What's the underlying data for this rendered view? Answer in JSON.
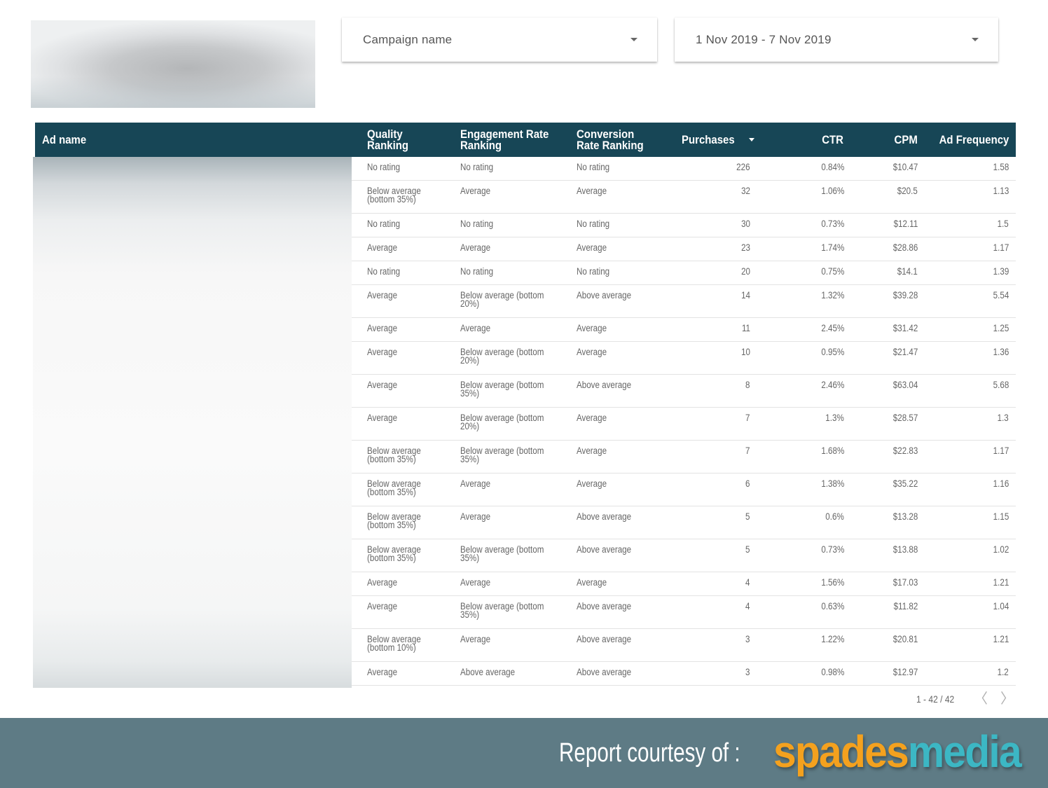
{
  "header": {
    "logo_alt": "blurred-report-logo"
  },
  "filters": {
    "campaign": {
      "label": "Campaign name",
      "icon": "caret-down-icon"
    },
    "date_range": {
      "label": "1 Nov 2019 - 7 Nov 2019",
      "icon": "caret-down-icon"
    }
  },
  "table": {
    "header_bg": "#174656",
    "columns": [
      {
        "key": "ad_name",
        "label": "Ad name"
      },
      {
        "key": "quality_ranking",
        "label": "Quality Ranking"
      },
      {
        "key": "engagement_rate_ranking",
        "label": "Engagement Rate Ranking"
      },
      {
        "key": "conversion_rate_ranking",
        "label": "Conversion Rate Ranking"
      },
      {
        "key": "purchases",
        "label": "Purchases",
        "sorted": "descending",
        "sort_icon": "sort-desc-caret-icon"
      },
      {
        "key": "ctr",
        "label": "CTR"
      },
      {
        "key": "cpm",
        "label": "CPM"
      },
      {
        "key": "ad_frequency",
        "label": "Ad Frequency"
      }
    ],
    "rows": [
      {
        "quality": "No rating",
        "engagement": "No rating",
        "conversion": "No rating",
        "purchases": "226",
        "ctr": "0.84%",
        "cpm": "$10.47",
        "frequency": "1.58"
      },
      {
        "quality": "Below average (bottom 35%)",
        "engagement": "Average",
        "conversion": "Average",
        "purchases": "32",
        "ctr": "1.06%",
        "cpm": "$20.5",
        "frequency": "1.13"
      },
      {
        "quality": "No rating",
        "engagement": "No rating",
        "conversion": "No rating",
        "purchases": "30",
        "ctr": "0.73%",
        "cpm": "$12.11",
        "frequency": "1.5"
      },
      {
        "quality": "Average",
        "engagement": "Average",
        "conversion": "Average",
        "purchases": "23",
        "ctr": "1.74%",
        "cpm": "$28.86",
        "frequency": "1.17"
      },
      {
        "quality": "No rating",
        "engagement": "No rating",
        "conversion": "No rating",
        "purchases": "20",
        "ctr": "0.75%",
        "cpm": "$14.1",
        "frequency": "1.39"
      },
      {
        "quality": "Average",
        "engagement": "Below average (bottom 20%)",
        "conversion": "Above average",
        "purchases": "14",
        "ctr": "1.32%",
        "cpm": "$39.28",
        "frequency": "5.54"
      },
      {
        "quality": "Average",
        "engagement": "Average",
        "conversion": "Average",
        "purchases": "11",
        "ctr": "2.45%",
        "cpm": "$31.42",
        "frequency": "1.25"
      },
      {
        "quality": "Average",
        "engagement": "Below average (bottom 20%)",
        "conversion": "Average",
        "purchases": "10",
        "ctr": "0.95%",
        "cpm": "$21.47",
        "frequency": "1.36"
      },
      {
        "quality": "Average",
        "engagement": "Below average (bottom 35%)",
        "conversion": "Above average",
        "purchases": "8",
        "ctr": "2.46%",
        "cpm": "$63.04",
        "frequency": "5.68"
      },
      {
        "quality": "Average",
        "engagement": "Below average (bottom 20%)",
        "conversion": "Average",
        "purchases": "7",
        "ctr": "1.3%",
        "cpm": "$28.57",
        "frequency": "1.3"
      },
      {
        "quality": "Below average (bottom 35%)",
        "engagement": "Below average (bottom 35%)",
        "conversion": "Average",
        "purchases": "7",
        "ctr": "1.68%",
        "cpm": "$22.83",
        "frequency": "1.17"
      },
      {
        "quality": "Below average (bottom 35%)",
        "engagement": "Average",
        "conversion": "Average",
        "purchases": "6",
        "ctr": "1.38%",
        "cpm": "$35.22",
        "frequency": "1.16"
      },
      {
        "quality": "Below average (bottom 35%)",
        "engagement": "Average",
        "conversion": "Above average",
        "purchases": "5",
        "ctr": "0.6%",
        "cpm": "$13.28",
        "frequency": "1.15"
      },
      {
        "quality": "Below average (bottom 35%)",
        "engagement": "Below average (bottom 35%)",
        "conversion": "Above average",
        "purchases": "5",
        "ctr": "0.73%",
        "cpm": "$13.88",
        "frequency": "1.02"
      },
      {
        "quality": "Average",
        "engagement": "Average",
        "conversion": "Average",
        "purchases": "4",
        "ctr": "1.56%",
        "cpm": "$17.03",
        "frequency": "1.21"
      },
      {
        "quality": "Average",
        "engagement": "Below average (bottom 35%)",
        "conversion": "Above average",
        "purchases": "4",
        "ctr": "0.63%",
        "cpm": "$11.82",
        "frequency": "1.04"
      },
      {
        "quality": "Below average (bottom 10%)",
        "engagement": "Average",
        "conversion": "Above average",
        "purchases": "3",
        "ctr": "1.22%",
        "cpm": "$20.81",
        "frequency": "1.21"
      },
      {
        "quality": "Average",
        "engagement": "Above average",
        "conversion": "Above average",
        "purchases": "3",
        "ctr": "0.98%",
        "cpm": "$12.97",
        "frequency": "1.2"
      }
    ],
    "pagination": {
      "range_label": "1 - 42 / 42",
      "prev_glyph": "〈",
      "next_glyph": "〉"
    }
  },
  "footer": {
    "courtesy_text": "Report courtesy of :",
    "brand_part1": "spades",
    "brand_part2": "media",
    "brand_color1": "#f4a11e",
    "brand_color2": "#3cb7c4",
    "background": "#5e7b85"
  }
}
